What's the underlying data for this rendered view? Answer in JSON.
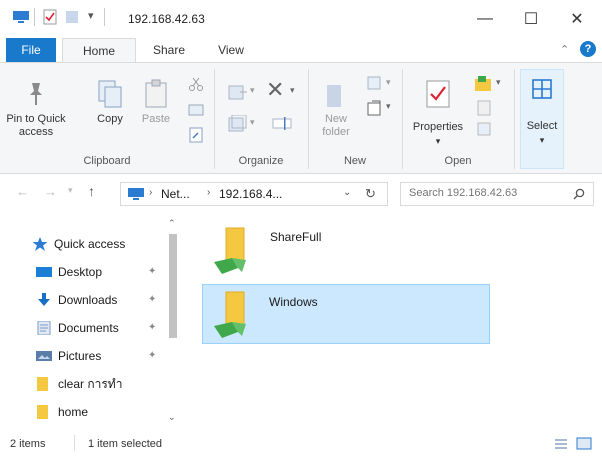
{
  "window": {
    "title": "192.168.42.63",
    "minimize": "—",
    "maximize": "☐",
    "close": "✕"
  },
  "tabs": [
    {
      "label": "File"
    },
    {
      "label": "Home"
    },
    {
      "label": "Share"
    },
    {
      "label": "View"
    }
  ],
  "ribbon": {
    "pin_line1": "Pin to Quick",
    "pin_line2": "access",
    "copy": "Copy",
    "paste": "Paste",
    "clipboard_group": "Clipboard",
    "organize_group": "Organize",
    "new_folder_line1": "New",
    "new_folder_line2": "folder",
    "new_group": "New",
    "properties": "Properties",
    "open_group": "Open",
    "select": "Select"
  },
  "address": {
    "seg1": "Net...",
    "seg2": "192.168.4...",
    "search_placeholder": "Search 192.168.42.63"
  },
  "nav": {
    "quick_access": "Quick access",
    "items": [
      {
        "label": "Desktop"
      },
      {
        "label": "Downloads"
      },
      {
        "label": "Documents"
      },
      {
        "label": "Pictures"
      },
      {
        "label": "clear การทำ"
      },
      {
        "label": "home"
      }
    ]
  },
  "files": [
    {
      "name": "ShareFull"
    },
    {
      "name": "Windows"
    }
  ],
  "status": {
    "items": "2 items",
    "selected": "1 item selected"
  },
  "colors": {
    "accent": "#1979ca",
    "selection": "#cce8ff",
    "selection_border": "#99d1ff",
    "folder": "#f5c842",
    "share_green": "#3ea84a"
  }
}
